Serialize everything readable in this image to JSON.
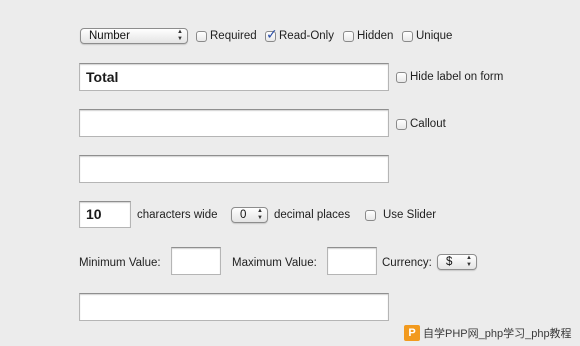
{
  "field_type": {
    "value": "Number"
  },
  "options": {
    "required": {
      "label": "Required",
      "checked": false
    },
    "read_only": {
      "label": "Read-Only",
      "checked": true
    },
    "hidden": {
      "label": "Hidden",
      "checked": false
    },
    "unique": {
      "label": "Unique",
      "checked": false
    }
  },
  "label_field": {
    "value": "Total"
  },
  "hide_label": {
    "label": "Hide label on form",
    "checked": false
  },
  "field2": {
    "value": ""
  },
  "callout": {
    "label": "Callout",
    "checked": false
  },
  "field3": {
    "value": ""
  },
  "width": {
    "value": "10",
    "suffix": "characters wide"
  },
  "decimals": {
    "value": "0",
    "suffix": "decimal places"
  },
  "use_slider": {
    "label": "Use Slider",
    "checked": false
  },
  "minimum": {
    "label": "Minimum Value:",
    "value": ""
  },
  "maximum": {
    "label": "Maximum Value:",
    "value": ""
  },
  "currency": {
    "label": "Currency:",
    "value": "$"
  },
  "field4": {
    "value": ""
  },
  "watermark": {
    "logo": "P",
    "text": "自学PHP网_php学习_php教程"
  }
}
